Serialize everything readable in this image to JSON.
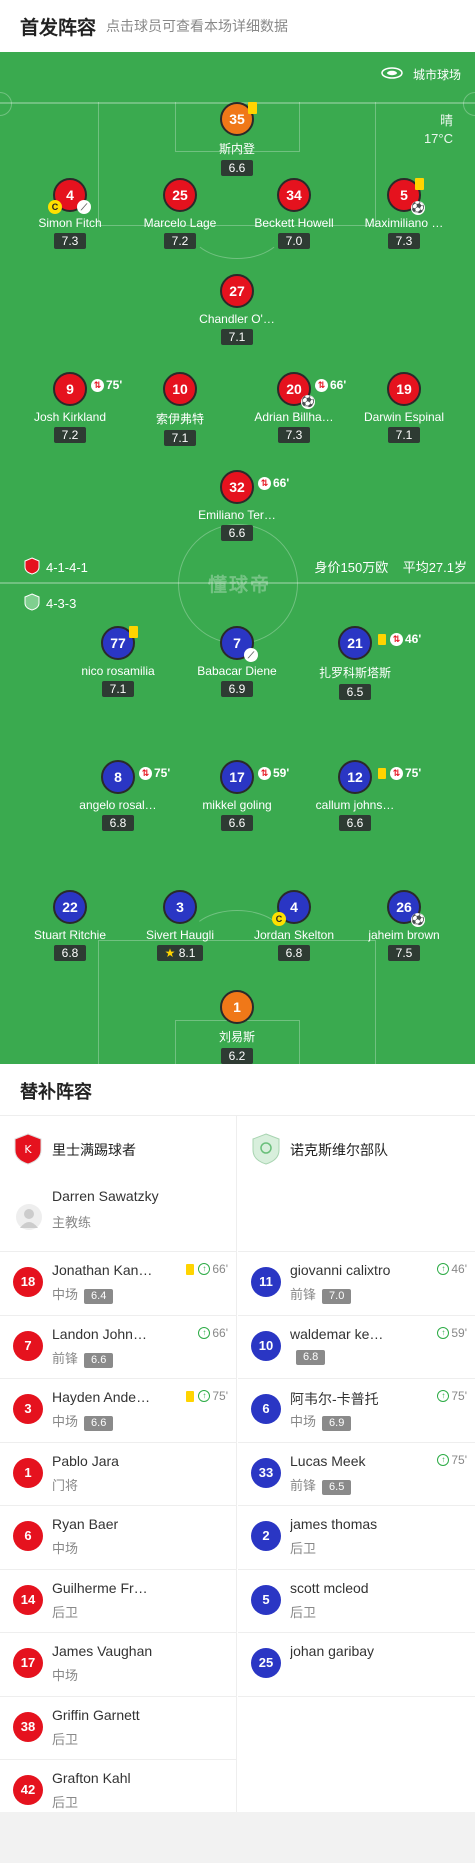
{
  "header": {
    "title": "首发阵容",
    "subtitle": "点击球员可查看本场详细数据"
  },
  "venue": {
    "name": "城市球场"
  },
  "weather": {
    "condition": "晴",
    "temp": "17°C"
  },
  "watermark": "懂球帝",
  "home": {
    "formation": "4-1-4-1",
    "value": "身价150万欧",
    "age": "平均27.1岁"
  },
  "away": {
    "formation": "4-3-3"
  },
  "home_players": [
    {
      "num": "35",
      "name": "斯内登",
      "rating": "6.6",
      "color": "orange"
    },
    {
      "num": "4",
      "name": "Simon Fitch",
      "rating": "7.3",
      "color": "red"
    },
    {
      "num": "25",
      "name": "Marcelo Lage",
      "rating": "7.2",
      "color": "red"
    },
    {
      "num": "34",
      "name": "Beckett Howell",
      "rating": "7.0",
      "color": "red"
    },
    {
      "num": "5",
      "name": "Maximiliano …",
      "rating": "7.3",
      "color": "red"
    },
    {
      "num": "27",
      "name": "Chandler O'…",
      "rating": "7.1",
      "color": "red"
    },
    {
      "num": "9",
      "name": "Josh Kirkland",
      "rating": "7.2",
      "color": "red",
      "sub": "75'"
    },
    {
      "num": "10",
      "name": "索伊弗特",
      "rating": "7.1",
      "color": "red"
    },
    {
      "num": "20",
      "name": "Adrian Billha…",
      "rating": "7.3",
      "color": "red",
      "sub": "66'"
    },
    {
      "num": "19",
      "name": "Darwin Espinal",
      "rating": "7.1",
      "color": "red"
    },
    {
      "num": "32",
      "name": "Emiliano Ter…",
      "rating": "6.6",
      "color": "red",
      "sub": "66'"
    }
  ],
  "away_players": [
    {
      "num": "77",
      "name": "nico rosamilia",
      "rating": "7.1",
      "color": "blue"
    },
    {
      "num": "7",
      "name": "Babacar Diene",
      "rating": "6.9",
      "color": "blue"
    },
    {
      "num": "21",
      "name": "扎罗科斯塔斯",
      "rating": "6.5",
      "color": "blue",
      "sub": "46'"
    },
    {
      "num": "8",
      "name": "angelo rosal…",
      "rating": "6.8",
      "color": "blue",
      "sub": "75'"
    },
    {
      "num": "17",
      "name": "mikkel goling",
      "rating": "6.6",
      "color": "blue",
      "sub": "59'"
    },
    {
      "num": "12",
      "name": "callum johns…",
      "rating": "6.6",
      "color": "blue",
      "sub": "75'"
    },
    {
      "num": "22",
      "name": "Stuart Ritchie",
      "rating": "6.8",
      "color": "blue"
    },
    {
      "num": "3",
      "name": "Sivert Haugli",
      "rating": "8.1",
      "color": "blue"
    },
    {
      "num": "4",
      "name": "Jordan Skelton",
      "rating": "6.8",
      "color": "blue"
    },
    {
      "num": "26",
      "name": "jaheim brown",
      "rating": "7.5",
      "color": "blue"
    },
    {
      "num": "1",
      "name": "刘易斯",
      "rating": "6.2",
      "color": "orange"
    }
  ],
  "subs": {
    "title": "替补阵容",
    "home_team": "里士满踢球者",
    "away_team": "诺克斯维尔部队",
    "coach_name": "Darren Sawatzky",
    "coach_role": "主教练",
    "home": [
      {
        "num": "18",
        "name": "Jonathan Kan…",
        "pos": "中场",
        "rating": "6.4",
        "min": "66'",
        "yellow": true
      },
      {
        "num": "7",
        "name": "Landon John…",
        "pos": "前锋",
        "rating": "6.6",
        "min": "66'"
      },
      {
        "num": "3",
        "name": "Hayden Ande…",
        "pos": "中场",
        "rating": "6.6",
        "min": "75'",
        "yellow": true
      },
      {
        "num": "1",
        "name": "Pablo Jara",
        "pos": "门将"
      },
      {
        "num": "6",
        "name": "Ryan Baer",
        "pos": "中场"
      },
      {
        "num": "14",
        "name": "Guilherme Fr…",
        "pos": "后卫"
      },
      {
        "num": "17",
        "name": "James Vaughan",
        "pos": "中场"
      },
      {
        "num": "38",
        "name": "Griffin Garnett",
        "pos": "后卫"
      },
      {
        "num": "42",
        "name": "Grafton Kahl",
        "pos": "后卫"
      }
    ],
    "away": [
      {
        "num": "11",
        "name": "giovanni calixtro",
        "pos": "前锋",
        "rating": "7.0",
        "min": "46'"
      },
      {
        "num": "10",
        "name": "waldemar ke…",
        "pos": "",
        "rating": "6.8",
        "min": "59'"
      },
      {
        "num": "6",
        "name": "阿韦尔-卡普托",
        "pos": "中场",
        "rating": "6.9",
        "min": "75'"
      },
      {
        "num": "33",
        "name": "Lucas Meek",
        "pos": "前锋",
        "rating": "6.5",
        "min": "75'"
      },
      {
        "num": "2",
        "name": "james thomas",
        "pos": "后卫"
      },
      {
        "num": "5",
        "name": "scott mcleod",
        "pos": "后卫"
      },
      {
        "num": "25",
        "name": "johan garibay",
        "pos": ""
      }
    ]
  },
  "colors": {
    "pitch": "#3aaa4f",
    "home": "#e5121e",
    "away": "#2a36c4",
    "keeper": "#f07818"
  }
}
